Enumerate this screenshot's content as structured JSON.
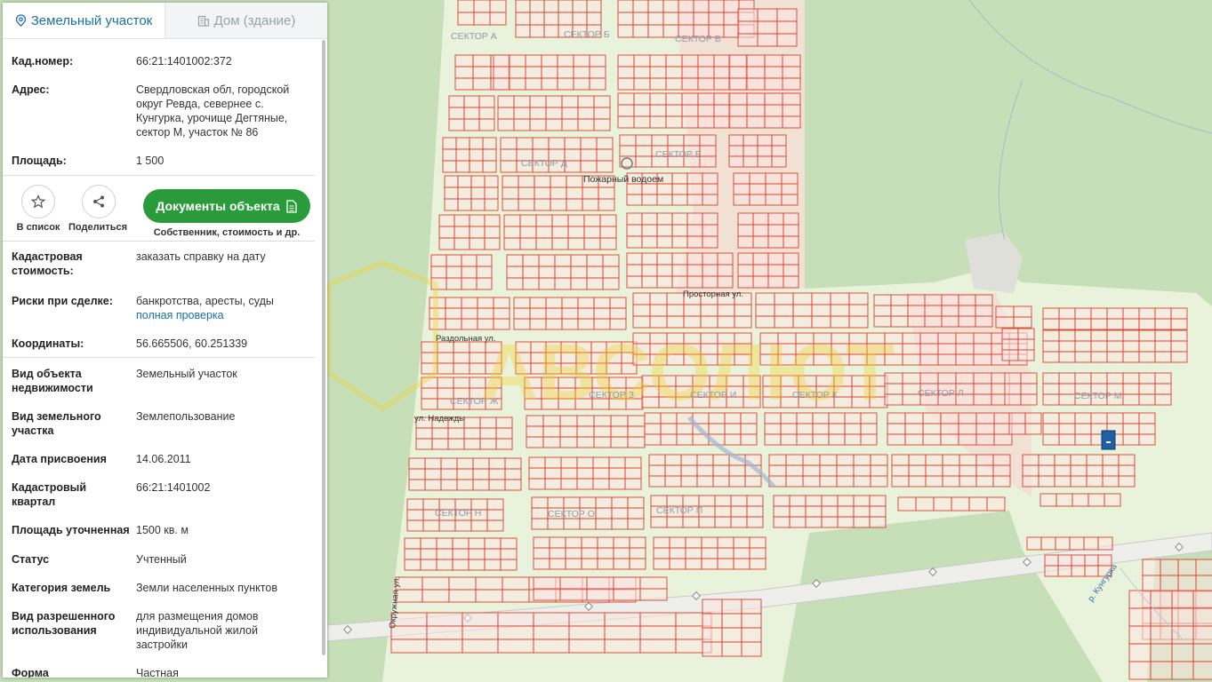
{
  "tabs": {
    "land": "Земельный участок",
    "building": "Дом (здание)"
  },
  "fields": {
    "cad_num_label": "Кад.номер:",
    "cad_num_value": "66:21:1401002:372",
    "address_label": "Адрес:",
    "address_value": "Свердловская обл, городской округ Ревда, севернее с. Кунгурка, урочище Дегтяные, сектор М, участок № 86",
    "area_label": "Площадь:",
    "area_value": "1 500",
    "cad_cost_label": "Кадастровая стоимость:",
    "cad_cost_link": "заказать справку на дату",
    "risks_label": "Риски при сделке:",
    "risks_value": "банкротства, аресты, суды",
    "risks_link": "полная проверка",
    "coords_label": "Координаты:",
    "coords_value": "56.665506, 60.251339",
    "obj_type_label": "Вид объекта недвижимости",
    "obj_type_value": "Земельный участок",
    "land_type_label": "Вид земельного участка",
    "land_type_value": "Землепользование",
    "date_label": "Дата присвоения",
    "date_value": "14.06.2011",
    "quarter_label": "Кадастровый квартал",
    "quarter_value": "66:21:1401002",
    "area_spec_label": "Площадь уточненная",
    "area_spec_value": "1500 кв. м",
    "status_label": "Статус",
    "status_value": "Учтенный",
    "category_label": "Категория земель",
    "category_value": "Земли населенных пунктов",
    "permitted_label": "Вид разрешенного использования",
    "permitted_value": "для размещения домов индивидуальной жилой застройки",
    "form_label": "Форма",
    "form_value": "Частная"
  },
  "actions": {
    "favorite": "В список",
    "share": "Поделиться",
    "documents": "Документы объекта",
    "documents_sub": "Собственник, стоимость и др."
  },
  "map_labels": {
    "sector_a": "СЕКТОР А",
    "sector_b": "СЕКТОР Б",
    "sector_v": "СЕКТОР В",
    "sector_d": "СЕКТОР Д",
    "sector_e": "СЕКТОР Е",
    "fire_pond": "Пожарный водоем",
    "prostornaya": "Просторная ул.",
    "razdolnaya": "Раздольная ул.",
    "nadezhdy": "ул. Надежды",
    "sector_zh": "СЕКТОР Ж",
    "sector_z": "СЕКТОР З",
    "sector_i": "СЕКТОР И",
    "sector_k": "СЕКТОР К",
    "sector_l": "СЕКТОР Л",
    "sector_m": "СЕКТОР М",
    "sector_n": "СЕКТОР Н",
    "sector_o": "СЕКТОР О",
    "sector_p": "СЕКТОР П",
    "okruzhnaya": "Окружная ул.",
    "river": "р. Кунгурка"
  },
  "colors": {
    "accent": "#1a6fa8",
    "button": "#2a9b3a",
    "parcel_line": "#d9402b",
    "parcel_fill": "#fbe6e2",
    "forest": "#c7dfb9",
    "clearing": "#e9f3dc"
  }
}
